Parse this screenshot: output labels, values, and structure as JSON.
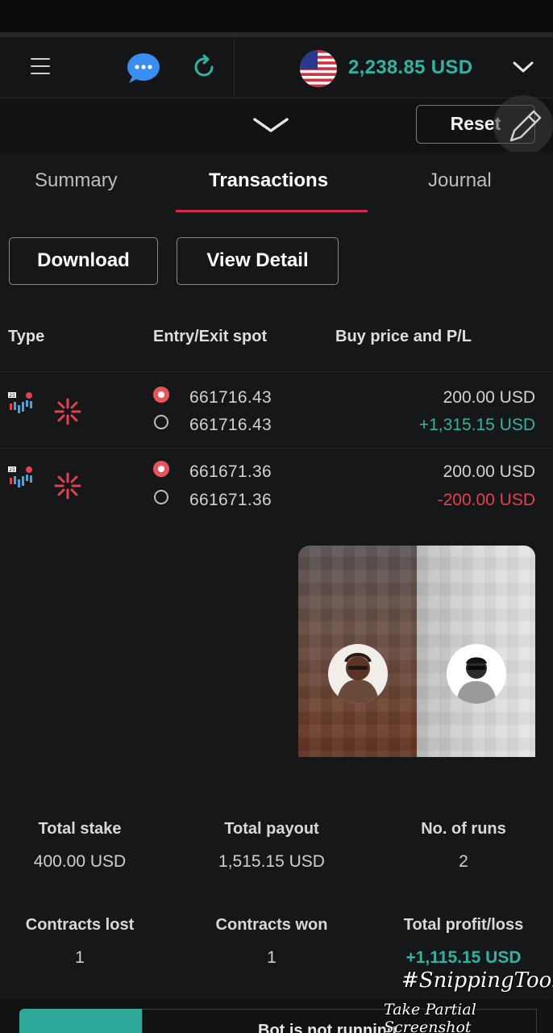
{
  "header": {
    "balance": "2,238.85 USD",
    "icons": [
      "menu-icon",
      "chat-icon",
      "refresh-icon",
      "us-flag-icon",
      "chevron-down-icon"
    ]
  },
  "toolbar": {
    "reset_label": "Reset",
    "icons": [
      "collapse-chevron-icon",
      "pencil-icon"
    ]
  },
  "tabs": [
    {
      "label": "Summary",
      "active": false
    },
    {
      "label": "Transactions",
      "active": true
    },
    {
      "label": "Journal",
      "active": false
    }
  ],
  "actions": {
    "download_label": "Download",
    "view_detail_label": "View Detail"
  },
  "table": {
    "headers": [
      "Type",
      "Entry/Exit spot",
      "Buy price and P/L"
    ],
    "rows": [
      {
        "entry_spot": "661716.43",
        "exit_spot": "661716.43",
        "buy_price": "200.00 USD",
        "pl": "+1,315.15 USD",
        "pl_color": "#2fb3a3"
      },
      {
        "entry_spot": "661671.36",
        "exit_spot": "661671.36",
        "buy_price": "200.00 USD",
        "pl": "-200.00 USD",
        "pl_color": "#e0424f"
      }
    ]
  },
  "stats": {
    "total_stake_label": "Total stake",
    "total_stake": "400.00 USD",
    "total_payout_label": "Total payout",
    "total_payout": "1,515.15 USD",
    "runs_label": "No. of runs",
    "runs": "2",
    "lost_label": "Contracts lost",
    "lost": "1",
    "won_label": "Contracts won",
    "won": "1",
    "profit_label": "Total profit/loss",
    "profit": "+1,115.15 USD"
  },
  "bot": {
    "status": "Bot is not running"
  },
  "watermark": {
    "line1": "#SnippingTool",
    "line2": "Take Partial Screenshot"
  },
  "colors": {
    "accent_green": "#2fb3a3",
    "accent_red": "#d22b4a",
    "background": "#161719"
  }
}
